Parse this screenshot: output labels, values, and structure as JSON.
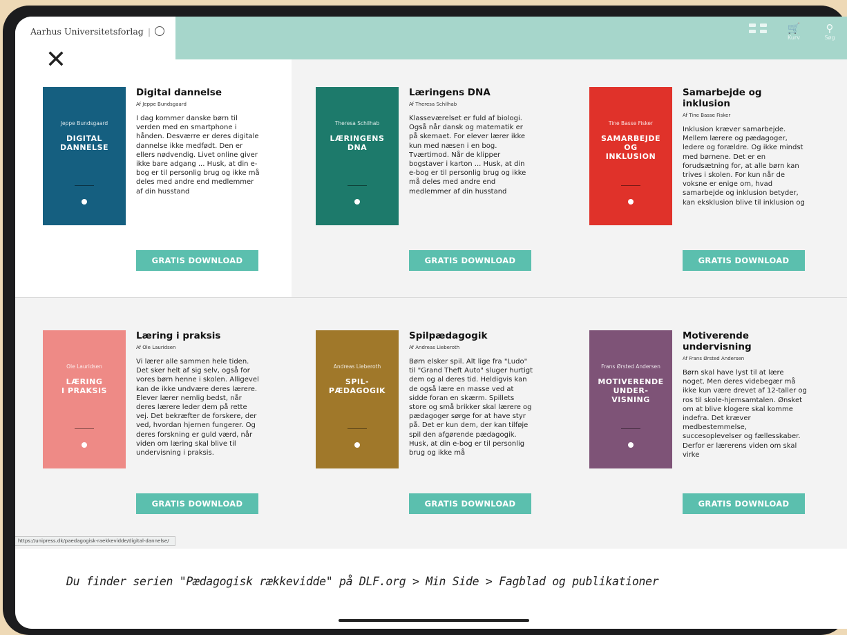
{
  "header": {
    "brand": "Aarhus Universitetsforlag",
    "brand_sep": "|",
    "icons": [
      {
        "name": "grid-icon",
        "label": ""
      },
      {
        "name": "cart-icon",
        "label": "Kurv"
      },
      {
        "name": "search-icon",
        "label": "Søg"
      }
    ],
    "close_icon": "✕"
  },
  "books": [
    {
      "title": "Digital dannelse",
      "author": "Af Jeppe Bundsgaard",
      "cover_author": "Jeppe Bundsgaard",
      "cover_title": "DIGITAL\nDANNELSE",
      "cover_color": "#155f80",
      "description": "I dag kommer danske børn til verden med en smartphone i hånden. Desværre er deres digitale dannelse ikke medfødt. Den er ellers nødvendig. Livet online giver ikke bare adgang ... Husk, at din e-bog er til personlig brug og ikke må deles med andre end medlemmer af din husstand",
      "button": "GRATIS DOWNLOAD"
    },
    {
      "title": "Læringens DNA",
      "author": "Af Theresa Schilhab",
      "cover_author": "Theresa Schilhab",
      "cover_title": "LÆRINGENS\nDNA",
      "cover_color": "#1d7a6b",
      "description": "Klasseværelset er fuld af biologi. Også når dansk og matematik er på skemaet. For elever lærer ikke kun med næsen i en bog. Tværtimod. Når de klipper bogstaver i karton ... Husk, at din e-bog er til personlig brug og ikke må deles med andre end medlemmer af din husstand",
      "button": "GRATIS DOWNLOAD"
    },
    {
      "title": "Samarbejde og inklusion",
      "author": "Af Tine Basse Fisker",
      "cover_author": "Tine Basse Fisker",
      "cover_title": "SAMARBEJDE\nOG\nINKLUSION",
      "cover_color": "#e0322a",
      "description": "Inklusion kræver samarbejde. Mellem lærere og pædagoger, ledere og forældre. Og ikke mindst med børnene. Det er en forudsætning for, at alle børn kan trives i skolen. For kun når de voksne er enige om, hvad samarbejde og inklusion betyder, kan eksklusion blive til inklusion og",
      "button": "GRATIS DOWNLOAD"
    },
    {
      "title": "Læring i praksis",
      "author": "Af Ole Lauridsen",
      "cover_author": "Ole Lauridsen",
      "cover_title": "LÆRING\nI PRAKSIS",
      "cover_color": "#ee8a86",
      "description": "Vi lærer alle sammen hele tiden. Det sker helt af sig selv, også for vores børn henne i skolen. Alligevel kan de ikke undvære deres lærere. Elever lærer nemlig bedst, når deres lærere leder dem på rette vej. Det bekræfter de forskere, der ved, hvordan hjernen fungerer. Og deres forskning er guld værd, når viden om læring skal blive til undervisning i praksis.",
      "button": "GRATIS DOWNLOAD"
    },
    {
      "title": "Spilpædagogik",
      "author": "Af Andreas Lieberoth",
      "cover_author": "Andreas Lieberoth",
      "cover_title": "SPIL-\nPÆDAGOGIK",
      "cover_color": "#a0782a",
      "description": "Børn elsker spil. Alt lige fra \"Ludo\" til \"Grand Theft Auto\" sluger hurtigt dem og al deres tid. Heldigvis kan de også lære en masse ved at sidde foran en skærm. Spillets store og små brikker skal lærere og pædagoger sørge for at have styr på. Det er kun dem, der kan tilføje spil den afgørende pædagogik. Husk, at din e-bog er til personlig brug og ikke må",
      "button": "GRATIS DOWNLOAD"
    },
    {
      "title": "Motiverende undervisning",
      "author": "Af Frans Ørsted Andersen",
      "cover_author": "Frans Ørsted Andersen",
      "cover_title": "MOTIVERENDE\nUNDER-\nVISNING",
      "cover_color": "#7e5377",
      "description": "Børn skal have lyst til at lære noget. Men deres videbegær må ikke kun være drevet af 12-taller og ros til skole-hjemsamtalen. Ønsket om at blive klogere skal komme indefra. Det kræver medbestemmelse, succesoplevelser og fællesskaber. Derfor er lærerens viden om skal virke",
      "button": "GRATIS DOWNLOAD"
    }
  ],
  "status_url": "https://unipress.dk/paedagogisk-raekkevidde/digital-dannelse/",
  "footer": "Du finder serien \"Pædagogisk rækkevidde\" på DLF.org > Min Side > Fagblad og publikationer"
}
